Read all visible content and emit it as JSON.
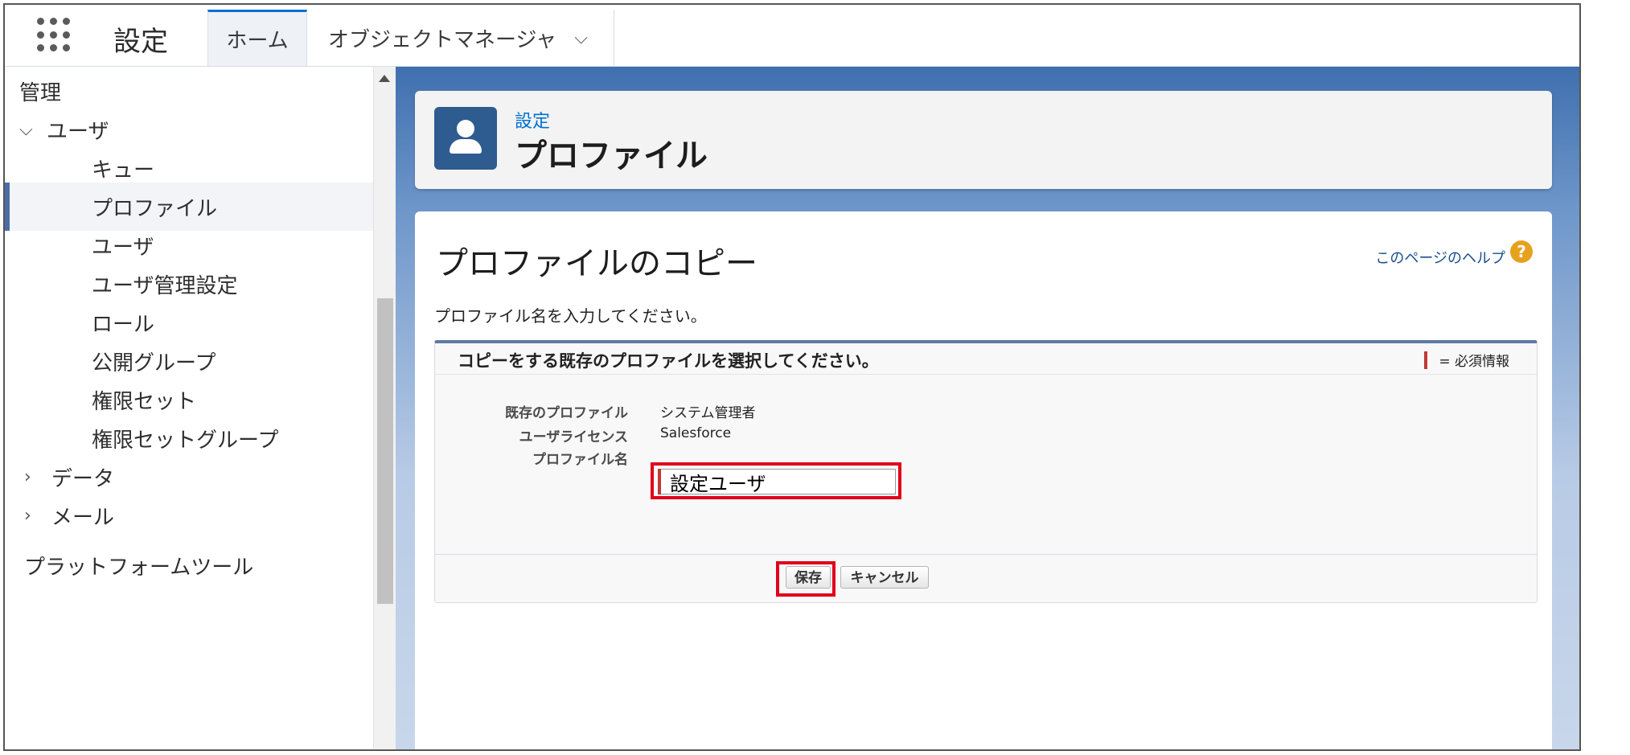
{
  "topbar": {
    "app_name": "設定",
    "tabs": [
      {
        "label": "ホーム"
      },
      {
        "label": "オブジェクトマネージャ"
      }
    ]
  },
  "sidebar": {
    "items": [
      {
        "label": "管理"
      },
      {
        "label": "ユーザ",
        "caret": "⌵"
      },
      {
        "label": "キュー"
      },
      {
        "label": "プロファイル"
      },
      {
        "label": "ユーザ"
      },
      {
        "label": "ユーザ管理設定"
      },
      {
        "label": "ロール"
      },
      {
        "label": "公開グループ"
      },
      {
        "label": "権限セット"
      },
      {
        "label": "権限セットグループ"
      },
      {
        "label": "データ",
        "caret": "›"
      },
      {
        "label": "メール",
        "caret": "›"
      },
      {
        "label": "プラットフォームツール"
      }
    ]
  },
  "header": {
    "breadcrumb": "設定",
    "title": "プロファイル"
  },
  "content": {
    "page_title": "プロファイルのコピー",
    "help_link": "このページのヘルプ",
    "instructions": "プロファイル名を入力してください。",
    "block_title": "コピーをする既存のプロファイルを選択してください。",
    "required_legend": "= 必須情報",
    "fields": {
      "existing_profile_label": "既存のプロファイル",
      "existing_profile_value": "システム管理者",
      "license_label": "ユーザライセンス",
      "license_value": "Salesforce",
      "name_label": "プロファイル名",
      "name_value": "設定ユーザ"
    },
    "buttons": {
      "save": "保存",
      "cancel": "キャンセル"
    }
  },
  "colors": {
    "accent": "#0070d2",
    "highlight": "#e0001a",
    "required": "#c23934"
  }
}
